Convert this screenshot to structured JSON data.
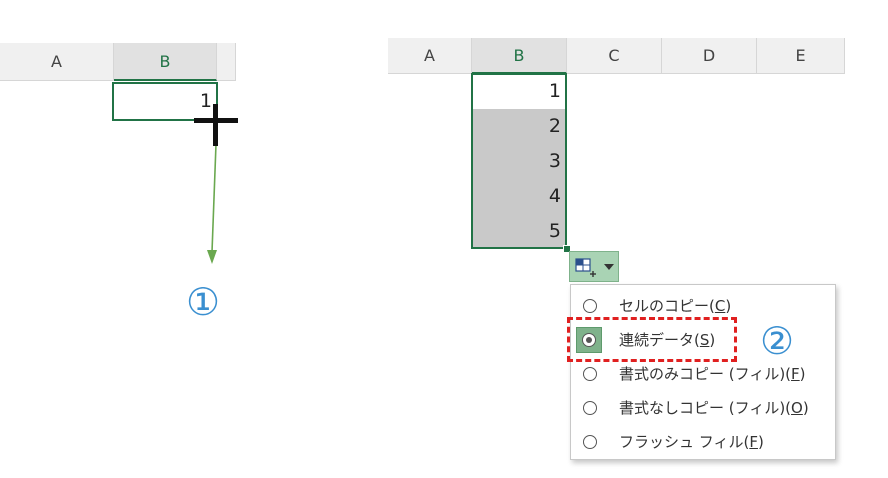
{
  "left_sheet": {
    "columns": [
      "A",
      "B"
    ],
    "cell_value": "1"
  },
  "right_sheet": {
    "columns": [
      "A",
      "B",
      "C",
      "D",
      "E"
    ],
    "values": [
      "1",
      "2",
      "3",
      "4",
      "5"
    ]
  },
  "step_markers": {
    "step1": "①",
    "step2": "②"
  },
  "autofill_menu": {
    "items": [
      {
        "label": "セルのコピー(",
        "key": "C",
        "suffix": ")"
      },
      {
        "label": "連続データ(",
        "key": "S",
        "suffix": ")"
      },
      {
        "label": "書式のみコピー (フィル)(",
        "key": "F",
        "suffix": ")"
      },
      {
        "label": "書式なしコピー (フィル)(",
        "key": "O",
        "suffix": ")"
      },
      {
        "label": "フラッシュ フィル(",
        "key": "F",
        "suffix": ")"
      }
    ],
    "selected_index": 1
  },
  "colors": {
    "excel_green": "#217346",
    "arrow_green": "#6aa84f",
    "highlight_red": "#e02020",
    "marker_blue": "#3a8fd0"
  }
}
